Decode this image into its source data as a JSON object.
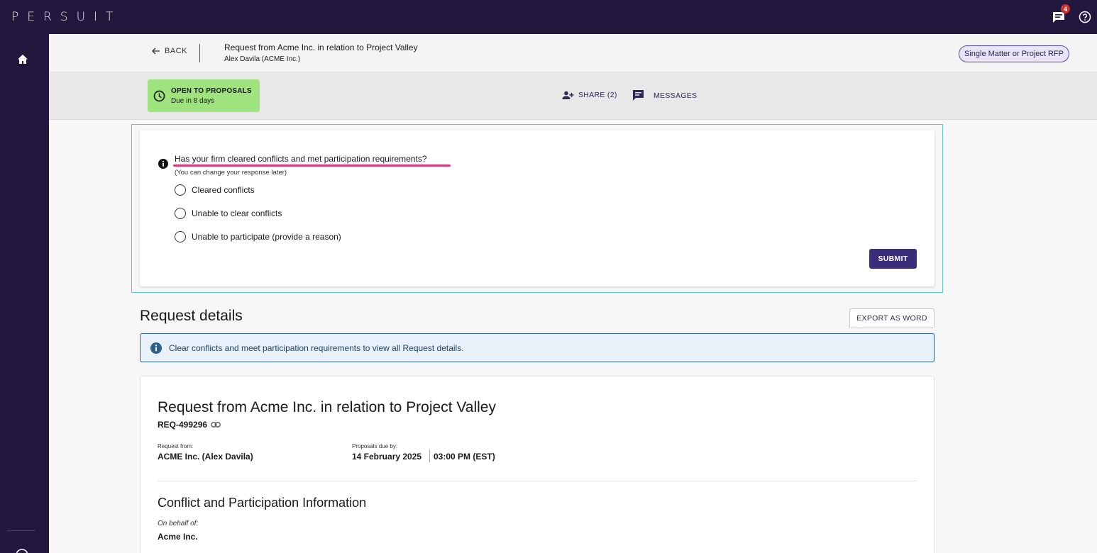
{
  "app": {
    "logo_text": "PERSUIT",
    "notification_count": "4"
  },
  "header": {
    "back_label": "BACK",
    "title": "Request from Acme Inc. in relation to Project Valley",
    "subtitle": "Alex Davila (ACME Inc.)",
    "rfp_type": "Single Matter or Project RFP"
  },
  "status": {
    "title": "OPEN TO PROPOSALS",
    "due": "Due in 8 days",
    "color": "#9ee37e"
  },
  "actions": {
    "share_label": "SHARE (2)",
    "messages_label": "MESSAGES"
  },
  "conflict_check": {
    "question": "Has your firm cleared conflicts and met participation requirements?",
    "hint": "(You can change your response later)",
    "options": [
      "Cleared conflicts",
      "Unable to clear conflicts",
      "Unable to participate (provide a reason)"
    ],
    "submit_label": "SUBMIT"
  },
  "request_details": {
    "heading": "Request details",
    "export_label": "EXPORT AS WORD",
    "info_message": "Clear conflicts and meet participation requirements to view all Request details."
  },
  "request_card": {
    "title": "Request from Acme Inc. in relation to Project Valley",
    "ref": "REQ-499296",
    "request_from_label": "Request from:",
    "request_from_value": "ACME Inc. (Alex Davila)",
    "due_label": "Proposals due by:",
    "due_date": "14 February 2025",
    "due_time": "03:00 PM (EST)",
    "section_title": "Conflict and Participation Information",
    "on_behalf_label": "On behalf of:",
    "on_behalf_value": "Acme Inc."
  },
  "colors": {
    "nav_bg": "#22183d",
    "primary": "#3b2d7a",
    "highlight_border": "#5ec9c0",
    "underline": "#d93a7a",
    "info_bg": "#e8f1fa"
  }
}
